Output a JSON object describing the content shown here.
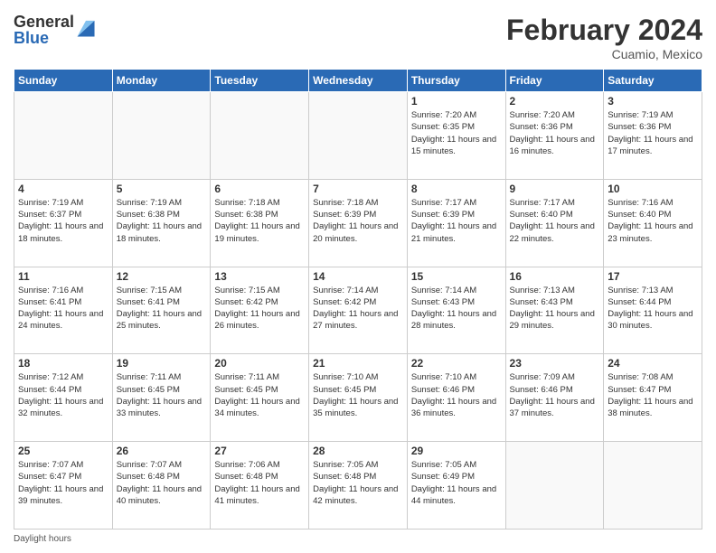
{
  "logo": {
    "general": "General",
    "blue": "Blue"
  },
  "title": "February 2024",
  "location": "Cuamio, Mexico",
  "days_of_week": [
    "Sunday",
    "Monday",
    "Tuesday",
    "Wednesday",
    "Thursday",
    "Friday",
    "Saturday"
  ],
  "footer": {
    "label": "Daylight hours"
  },
  "weeks": [
    [
      {
        "day": "",
        "sunrise": "",
        "sunset": "",
        "daylight": ""
      },
      {
        "day": "",
        "sunrise": "",
        "sunset": "",
        "daylight": ""
      },
      {
        "day": "",
        "sunrise": "",
        "sunset": "",
        "daylight": ""
      },
      {
        "day": "",
        "sunrise": "",
        "sunset": "",
        "daylight": ""
      },
      {
        "day": "1",
        "sunrise": "7:20 AM",
        "sunset": "6:35 PM",
        "daylight": "11 hours and 15 minutes."
      },
      {
        "day": "2",
        "sunrise": "7:20 AM",
        "sunset": "6:36 PM",
        "daylight": "11 hours and 16 minutes."
      },
      {
        "day": "3",
        "sunrise": "7:19 AM",
        "sunset": "6:36 PM",
        "daylight": "11 hours and 17 minutes."
      }
    ],
    [
      {
        "day": "4",
        "sunrise": "7:19 AM",
        "sunset": "6:37 PM",
        "daylight": "11 hours and 18 minutes."
      },
      {
        "day": "5",
        "sunrise": "7:19 AM",
        "sunset": "6:38 PM",
        "daylight": "11 hours and 18 minutes."
      },
      {
        "day": "6",
        "sunrise": "7:18 AM",
        "sunset": "6:38 PM",
        "daylight": "11 hours and 19 minutes."
      },
      {
        "day": "7",
        "sunrise": "7:18 AM",
        "sunset": "6:39 PM",
        "daylight": "11 hours and 20 minutes."
      },
      {
        "day": "8",
        "sunrise": "7:17 AM",
        "sunset": "6:39 PM",
        "daylight": "11 hours and 21 minutes."
      },
      {
        "day": "9",
        "sunrise": "7:17 AM",
        "sunset": "6:40 PM",
        "daylight": "11 hours and 22 minutes."
      },
      {
        "day": "10",
        "sunrise": "7:16 AM",
        "sunset": "6:40 PM",
        "daylight": "11 hours and 23 minutes."
      }
    ],
    [
      {
        "day": "11",
        "sunrise": "7:16 AM",
        "sunset": "6:41 PM",
        "daylight": "11 hours and 24 minutes."
      },
      {
        "day": "12",
        "sunrise": "7:15 AM",
        "sunset": "6:41 PM",
        "daylight": "11 hours and 25 minutes."
      },
      {
        "day": "13",
        "sunrise": "7:15 AM",
        "sunset": "6:42 PM",
        "daylight": "11 hours and 26 minutes."
      },
      {
        "day": "14",
        "sunrise": "7:14 AM",
        "sunset": "6:42 PM",
        "daylight": "11 hours and 27 minutes."
      },
      {
        "day": "15",
        "sunrise": "7:14 AM",
        "sunset": "6:43 PM",
        "daylight": "11 hours and 28 minutes."
      },
      {
        "day": "16",
        "sunrise": "7:13 AM",
        "sunset": "6:43 PM",
        "daylight": "11 hours and 29 minutes."
      },
      {
        "day": "17",
        "sunrise": "7:13 AM",
        "sunset": "6:44 PM",
        "daylight": "11 hours and 30 minutes."
      }
    ],
    [
      {
        "day": "18",
        "sunrise": "7:12 AM",
        "sunset": "6:44 PM",
        "daylight": "11 hours and 32 minutes."
      },
      {
        "day": "19",
        "sunrise": "7:11 AM",
        "sunset": "6:45 PM",
        "daylight": "11 hours and 33 minutes."
      },
      {
        "day": "20",
        "sunrise": "7:11 AM",
        "sunset": "6:45 PM",
        "daylight": "11 hours and 34 minutes."
      },
      {
        "day": "21",
        "sunrise": "7:10 AM",
        "sunset": "6:45 PM",
        "daylight": "11 hours and 35 minutes."
      },
      {
        "day": "22",
        "sunrise": "7:10 AM",
        "sunset": "6:46 PM",
        "daylight": "11 hours and 36 minutes."
      },
      {
        "day": "23",
        "sunrise": "7:09 AM",
        "sunset": "6:46 PM",
        "daylight": "11 hours and 37 minutes."
      },
      {
        "day": "24",
        "sunrise": "7:08 AM",
        "sunset": "6:47 PM",
        "daylight": "11 hours and 38 minutes."
      }
    ],
    [
      {
        "day": "25",
        "sunrise": "7:07 AM",
        "sunset": "6:47 PM",
        "daylight": "11 hours and 39 minutes."
      },
      {
        "day": "26",
        "sunrise": "7:07 AM",
        "sunset": "6:48 PM",
        "daylight": "11 hours and 40 minutes."
      },
      {
        "day": "27",
        "sunrise": "7:06 AM",
        "sunset": "6:48 PM",
        "daylight": "11 hours and 41 minutes."
      },
      {
        "day": "28",
        "sunrise": "7:05 AM",
        "sunset": "6:48 PM",
        "daylight": "11 hours and 42 minutes."
      },
      {
        "day": "29",
        "sunrise": "7:05 AM",
        "sunset": "6:49 PM",
        "daylight": "11 hours and 44 minutes."
      },
      {
        "day": "",
        "sunrise": "",
        "sunset": "",
        "daylight": ""
      },
      {
        "day": "",
        "sunrise": "",
        "sunset": "",
        "daylight": ""
      }
    ]
  ]
}
